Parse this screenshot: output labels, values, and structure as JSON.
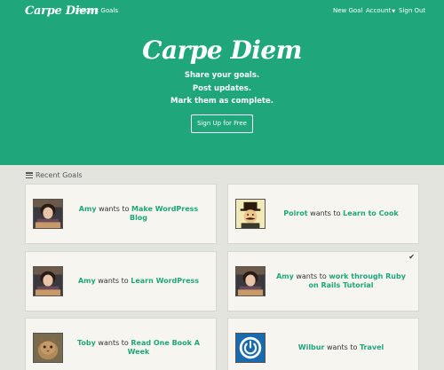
{
  "nav": {
    "brand": "Carpe Diem",
    "recent_goals": "Recent Goals",
    "new_goal": "New Goal",
    "account": "Account",
    "sign_out": "Sign Out"
  },
  "hero": {
    "title": "Carpe Diem",
    "lines": [
      "Share your goals.",
      "Post updates.",
      "Mark them as complete."
    ],
    "cta": "Sign Up for Free"
  },
  "section": {
    "heading": "Recent Goals"
  },
  "goals": [
    {
      "user": "Amy",
      "connector": "wants to",
      "goal": "Make WordPress Blog",
      "avatar": "amy-photo",
      "completed": false
    },
    {
      "user": "Poirot",
      "connector": "wants to",
      "goal": "Learn to Cook",
      "avatar": "poirot-illustration",
      "completed": false
    },
    {
      "user": "Amy",
      "connector": "wants to",
      "goal": "Learn WordPress",
      "avatar": "amy-photo",
      "completed": false
    },
    {
      "user": "Amy",
      "connector": "wants to",
      "goal": "work through Ruby on Rails Tutorial",
      "avatar": "amy-photo",
      "completed": true
    },
    {
      "user": "Toby",
      "connector": "wants to",
      "goal": "Read One Book A Week",
      "avatar": "cat-photo",
      "completed": false
    },
    {
      "user": "Wilbur",
      "connector": "wants to",
      "goal": "Travel",
      "avatar": "power-icon-logo",
      "completed": false
    }
  ],
  "colors": {
    "brand_green": "#1fa67a",
    "page_bg": "#e4e4de",
    "card_bg": "#f6f5f0"
  },
  "icons": {
    "list": "list-icon",
    "check": "check-icon"
  }
}
